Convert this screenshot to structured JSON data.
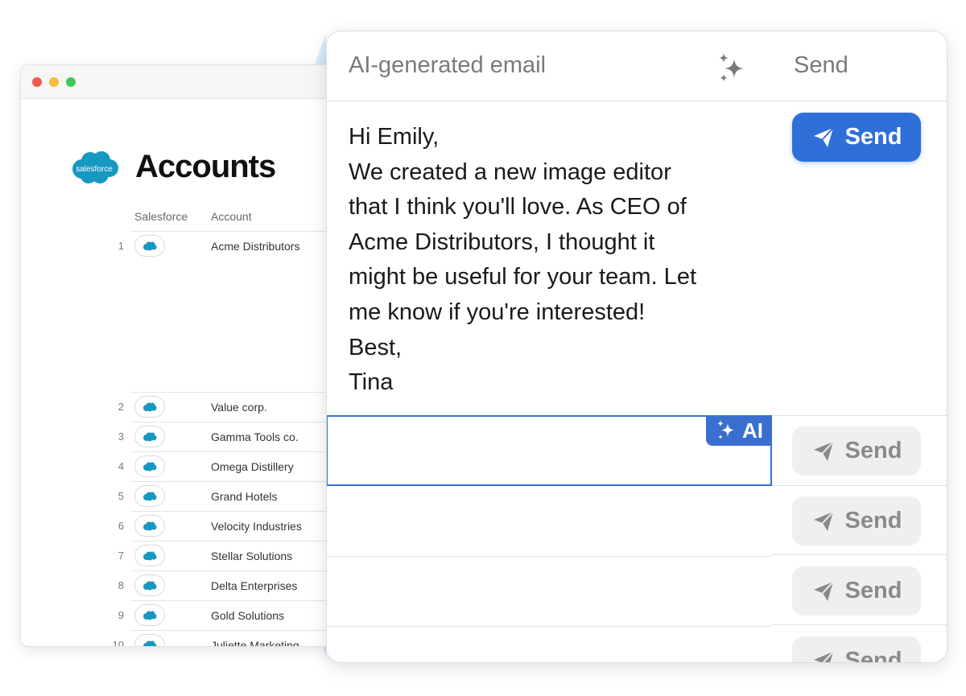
{
  "accounts_window": {
    "title": "Accounts",
    "logo_text": "salesforce",
    "columns": {
      "salesforce": "Salesforce",
      "account": "Account"
    },
    "rows": [
      {
        "num": "1",
        "name": "Acme Distributors"
      },
      {
        "num": "2",
        "name": "Value corp."
      },
      {
        "num": "3",
        "name": "Gamma Tools co."
      },
      {
        "num": "4",
        "name": "Omega Distillery"
      },
      {
        "num": "5",
        "name": "Grand Hotels"
      },
      {
        "num": "6",
        "name": "Velocity Industries"
      },
      {
        "num": "7",
        "name": "Stellar Solutions"
      },
      {
        "num": "8",
        "name": "Delta Enterprises"
      },
      {
        "num": "9",
        "name": "Gold Solutions"
      },
      {
        "num": "10",
        "name": "Juliette Marketing"
      }
    ]
  },
  "email_panel": {
    "header_title": "AI-generated email",
    "header_send": "Send",
    "email_text": "Hi Emily,\nWe created a new image editor\nthat I think you'll love. As CEO of\nAcme Distributors, I thought it\nmight be useful for your team. Let\nme know if you're interested!\nBest,\nTina",
    "ai_badge": "AI",
    "send_buttons": [
      "Send",
      "Send",
      "Send",
      "Send",
      "Send"
    ]
  },
  "colors": {
    "primary": "#2f6fd8",
    "salesforce_blue": "#1798c1",
    "disabled_bg": "#efefef"
  }
}
